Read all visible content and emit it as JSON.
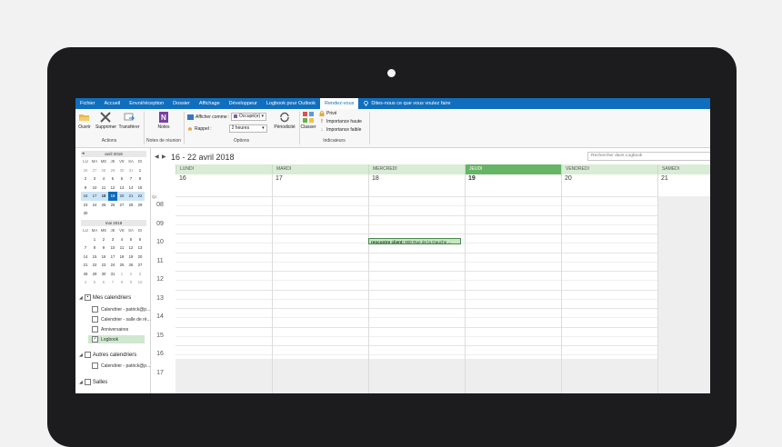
{
  "ribbon_tabs": [
    "Fichier",
    "Accueil",
    "Envoi/réception",
    "Dossier",
    "Affichage",
    "Développeur",
    "Logbook pour Outlook",
    "Rendez-vous"
  ],
  "active_tab": "Rendez-vous",
  "tell_me": "Dites-nous ce que vous voulez faire",
  "ribbon": {
    "actions": {
      "label": "Actions",
      "open": "Ouvrir",
      "delete": "Supprimer",
      "forward": "Transférer"
    },
    "meeting_notes": {
      "label": "Notes de réunion",
      "notes": "Notes"
    },
    "options": {
      "label": "Options",
      "show_as_label": "Afficher comme :",
      "show_as_value": "Occupé(e)",
      "reminder_label": "Rappel :",
      "reminder_value": "2 heures",
      "recurrence": "Périodicité"
    },
    "tags": {
      "label": "Indicateurs",
      "categorize": "Classer",
      "private": "Privé",
      "high_importance": "Importance haute",
      "low_importance": "Importance faible"
    }
  },
  "mini_calendars": [
    {
      "title": "avril 2018",
      "weekday_headers": [
        "LU",
        "MA",
        "ME",
        "JE",
        "VE",
        "SA",
        "DI"
      ],
      "weeks": [
        [
          "26",
          "27",
          "28",
          "29",
          "30",
          "31",
          "1"
        ],
        [
          "2",
          "3",
          "4",
          "5",
          "6",
          "7",
          "8"
        ],
        [
          "9",
          "10",
          "11",
          "12",
          "13",
          "14",
          "15"
        ],
        [
          "16",
          "17",
          "18",
          "19",
          "20",
          "21",
          "22"
        ],
        [
          "23",
          "24",
          "25",
          "26",
          "27",
          "28",
          "29"
        ],
        [
          "30",
          "",
          "",
          "",
          "",
          "",
          ""
        ]
      ]
    },
    {
      "title": "mai 2018",
      "weekday_headers": [
        "LU",
        "MA",
        "ME",
        "JE",
        "VE",
        "SA",
        "DI"
      ],
      "weeks": [
        [
          "",
          "1",
          "2",
          "3",
          "4",
          "5",
          "6"
        ],
        [
          "7",
          "8",
          "9",
          "10",
          "11",
          "12",
          "13"
        ],
        [
          "14",
          "15",
          "16",
          "17",
          "18",
          "19",
          "20"
        ],
        [
          "21",
          "22",
          "23",
          "24",
          "25",
          "26",
          "27"
        ],
        [
          "28",
          "29",
          "30",
          "31",
          "1",
          "2",
          "3"
        ],
        [
          "4",
          "5",
          "6",
          "7",
          "8",
          "9",
          "10"
        ]
      ]
    }
  ],
  "nav": {
    "my_calendars": "Mes calendriers",
    "my_calendar_items": [
      {
        "label": "Calendrier - patrick@p...",
        "checked": false
      },
      {
        "label": "Calendrier - salle de ré...",
        "checked": false
      },
      {
        "label": "Anniversaires",
        "checked": false
      },
      {
        "label": "Logbook",
        "checked": true
      }
    ],
    "other_calendars": "Autres calendriers",
    "other_calendar_items": [
      {
        "label": "Calendrier - patrick@p...",
        "checked": false
      }
    ],
    "rooms": "Salles"
  },
  "calendar": {
    "range_title": "16 - 22 avril 2018",
    "search_placeholder": "Rechercher dans Logbook",
    "timezone": "Qc",
    "days": [
      {
        "name": "LUNDI",
        "date": "16"
      },
      {
        "name": "MARDI",
        "date": "17"
      },
      {
        "name": "MERCREDI",
        "date": "18"
      },
      {
        "name": "JEUDI",
        "date": "19"
      },
      {
        "name": "VENDREDI",
        "date": "20"
      },
      {
        "name": "SAMEDI",
        "date": "21"
      }
    ],
    "today_index": 3,
    "hours": [
      "08",
      "09",
      "10",
      "11",
      "12",
      "13",
      "14",
      "15",
      "16",
      "17"
    ],
    "appointment": {
      "title": "rencontre client;",
      "location": "900 Rue de la Gauche ...",
      "day_index": 2,
      "start_hour": 10.25
    }
  }
}
